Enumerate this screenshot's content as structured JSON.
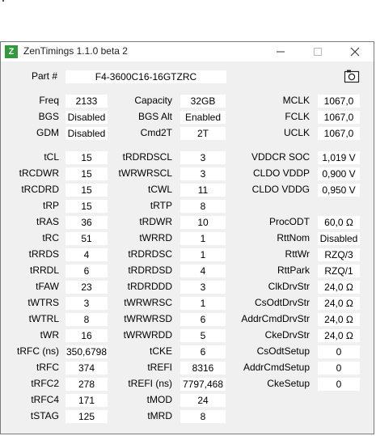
{
  "window": {
    "title": "ZenTimings 1.1.0 beta 2",
    "app_icon_letter": "Z"
  },
  "part": {
    "label": "Part #",
    "value": "F4-3600C16-16GTZRC"
  },
  "top": [
    [
      {
        "label": "Freq",
        "value": "2133"
      },
      {
        "label": "Capacity",
        "value": "32GB"
      },
      {
        "label": "MCLK",
        "value": "1067,0"
      }
    ],
    [
      {
        "label": "BGS",
        "value": "Disabled"
      },
      {
        "label": "BGS Alt",
        "value": "Enabled"
      },
      {
        "label": "FCLK",
        "value": "1067,0"
      }
    ],
    [
      {
        "label": "GDM",
        "value": "Disabled"
      },
      {
        "label": "Cmd2T",
        "value": "2T"
      },
      {
        "label": "UCLK",
        "value": "1067,0"
      }
    ]
  ],
  "col1": [
    {
      "label": "tCL",
      "value": "15"
    },
    {
      "label": "tRCDWR",
      "value": "15"
    },
    {
      "label": "tRCDRD",
      "value": "15"
    },
    {
      "label": "tRP",
      "value": "15"
    },
    {
      "label": "tRAS",
      "value": "36"
    },
    {
      "label": "tRC",
      "value": "51"
    },
    {
      "label": "tRRDS",
      "value": "4"
    },
    {
      "label": "tRRDL",
      "value": "6"
    },
    {
      "label": "tFAW",
      "value": "23"
    },
    {
      "label": "tWTRS",
      "value": "3"
    },
    {
      "label": "tWTRL",
      "value": "8"
    },
    {
      "label": "tWR",
      "value": "16"
    },
    {
      "label": "tRFC (ns)",
      "value": "350,6798"
    },
    {
      "label": "tRFC",
      "value": "374"
    },
    {
      "label": "tRFC2",
      "value": "278"
    },
    {
      "label": "tRFC4",
      "value": "171"
    },
    {
      "label": "tSTAG",
      "value": "125"
    }
  ],
  "col2": [
    {
      "label": "tRDRDSCL",
      "value": "3"
    },
    {
      "label": "tWRWRSCL",
      "value": "3"
    },
    {
      "label": "tCWL",
      "value": "11"
    },
    {
      "label": "tRTP",
      "value": "8"
    },
    {
      "label": "tRDWR",
      "value": "10"
    },
    {
      "label": "tWRRD",
      "value": "1"
    },
    {
      "label": "tRDRDSC",
      "value": "1"
    },
    {
      "label": "tRDRDSD",
      "value": "4"
    },
    {
      "label": "tRDRDDD",
      "value": "3"
    },
    {
      "label": "tWRWRSC",
      "value": "1"
    },
    {
      "label": "tWRWRSD",
      "value": "6"
    },
    {
      "label": "tWRWRDD",
      "value": "5"
    },
    {
      "label": "tCKE",
      "value": "6"
    },
    {
      "label": "tREFI",
      "value": "8316"
    },
    {
      "label": "tREFI (ns)",
      "value": "7797,468"
    },
    {
      "label": "tMOD",
      "value": "24"
    },
    {
      "label": "tMRD",
      "value": "8"
    }
  ],
  "col3": [
    {
      "label": "VDDCR SOC",
      "value": "1,019 V"
    },
    {
      "label": "CLDO VDDP",
      "value": "0,900 V"
    },
    {
      "label": "CLDO VDDG",
      "value": "0,950 V"
    },
    {
      "label": "",
      "value": ""
    },
    {
      "label": "ProcODT",
      "value": "60,0 Ω"
    },
    {
      "label": "RttNom",
      "value": "Disabled"
    },
    {
      "label": "RttWr",
      "value": "RZQ/3"
    },
    {
      "label": "RttPark",
      "value": "RZQ/1"
    },
    {
      "label": "ClkDrvStr",
      "value": "24,0 Ω"
    },
    {
      "label": "CsOdtDrvStr",
      "value": "24,0 Ω"
    },
    {
      "label": "AddrCmdDrvStr",
      "value": "24,0 Ω"
    },
    {
      "label": "CkeDrvStr",
      "value": "24,0 Ω"
    },
    {
      "label": "CsOdtSetup",
      "value": "0"
    },
    {
      "label": "AddrCmdSetup",
      "value": "0"
    },
    {
      "label": "CkeSetup",
      "value": "0"
    },
    {
      "label": "",
      "value": ""
    },
    {
      "label": "",
      "value": ""
    }
  ]
}
